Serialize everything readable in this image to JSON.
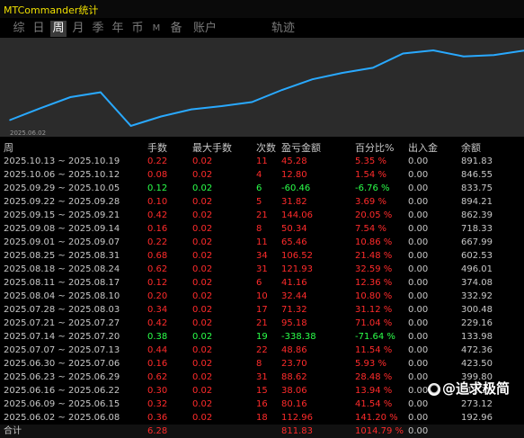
{
  "window": {
    "title": "MTCommander统计"
  },
  "tabs": [
    {
      "label": "综",
      "active": false
    },
    {
      "label": "日",
      "active": false
    },
    {
      "label": "周",
      "active": true
    },
    {
      "label": "月",
      "active": false
    },
    {
      "label": "季",
      "active": false
    },
    {
      "label": "年",
      "active": false
    },
    {
      "label": "币",
      "active": false
    },
    {
      "label": "M",
      "active": false
    },
    {
      "label": "备",
      "active": false
    },
    {
      "label": "账户",
      "active": false
    },
    {
      "label": "轨迹",
      "active": false
    }
  ],
  "chart_data": {
    "type": "line",
    "x_start_label": "2025.06.02",
    "series": [
      {
        "values": [
          192.96,
          311.18,
          423.5,
          472.36,
          133.98,
          229.16,
          300.48,
          332.92,
          374.08,
          496.01,
          602.53,
          667.99,
          718.33,
          862.39,
          894.21,
          833.75,
          846.55,
          891.83
        ]
      }
    ],
    "color": "#29a9ff",
    "background": "#2b2b2b"
  },
  "table": {
    "headers": {
      "date": "周",
      "lots": "手数",
      "max_lots": "最大手数",
      "count": "次数",
      "pnl": "盈亏金额",
      "pct": "百分比%",
      "inout": "出入金",
      "balance": "余额"
    },
    "rows": [
      {
        "date": "2025.10.13 ~ 2025.10.19",
        "lots": "0.22",
        "max": "0.02",
        "cnt": "11",
        "pnl": "45.28",
        "pct": "5.35 %",
        "io": "0.00",
        "bal": "891.83",
        "sign": "pos"
      },
      {
        "date": "2025.10.06 ~ 2025.10.12",
        "lots": "0.08",
        "max": "0.02",
        "cnt": "4",
        "pnl": "12.80",
        "pct": "1.54 %",
        "io": "0.00",
        "bal": "846.55",
        "sign": "pos"
      },
      {
        "date": "2025.09.29 ~ 2025.10.05",
        "lots": "0.12",
        "max": "0.02",
        "cnt": "6",
        "pnl": "-60.46",
        "pct": "-6.76 %",
        "io": "0.00",
        "bal": "833.75",
        "sign": "neg"
      },
      {
        "date": "2025.09.22 ~ 2025.09.28",
        "lots": "0.10",
        "max": "0.02",
        "cnt": "5",
        "pnl": "31.82",
        "pct": "3.69 %",
        "io": "0.00",
        "bal": "894.21",
        "sign": "pos"
      },
      {
        "date": "2025.09.15 ~ 2025.09.21",
        "lots": "0.42",
        "max": "0.02",
        "cnt": "21",
        "pnl": "144.06",
        "pct": "20.05 %",
        "io": "0.00",
        "bal": "862.39",
        "sign": "pos"
      },
      {
        "date": "2025.09.08 ~ 2025.09.14",
        "lots": "0.16",
        "max": "0.02",
        "cnt": "8",
        "pnl": "50.34",
        "pct": "7.54 %",
        "io": "0.00",
        "bal": "718.33",
        "sign": "pos"
      },
      {
        "date": "2025.09.01 ~ 2025.09.07",
        "lots": "0.22",
        "max": "0.02",
        "cnt": "11",
        "pnl": "65.46",
        "pct": "10.86 %",
        "io": "0.00",
        "bal": "667.99",
        "sign": "pos"
      },
      {
        "date": "2025.08.25 ~ 2025.08.31",
        "lots": "0.68",
        "max": "0.02",
        "cnt": "34",
        "pnl": "106.52",
        "pct": "21.48 %",
        "io": "0.00",
        "bal": "602.53",
        "sign": "pos"
      },
      {
        "date": "2025.08.18 ~ 2025.08.24",
        "lots": "0.62",
        "max": "0.02",
        "cnt": "31",
        "pnl": "121.93",
        "pct": "32.59 %",
        "io": "0.00",
        "bal": "496.01",
        "sign": "pos"
      },
      {
        "date": "2025.08.11 ~ 2025.08.17",
        "lots": "0.12",
        "max": "0.02",
        "cnt": "6",
        "pnl": "41.16",
        "pct": "12.36 %",
        "io": "0.00",
        "bal": "374.08",
        "sign": "pos"
      },
      {
        "date": "2025.08.04 ~ 2025.08.10",
        "lots": "0.20",
        "max": "0.02",
        "cnt": "10",
        "pnl": "32.44",
        "pct": "10.80 %",
        "io": "0.00",
        "bal": "332.92",
        "sign": "pos"
      },
      {
        "date": "2025.07.28 ~ 2025.08.03",
        "lots": "0.34",
        "max": "0.02",
        "cnt": "17",
        "pnl": "71.32",
        "pct": "31.12 %",
        "io": "0.00",
        "bal": "300.48",
        "sign": "pos"
      },
      {
        "date": "2025.07.21 ~ 2025.07.27",
        "lots": "0.42",
        "max": "0.02",
        "cnt": "21",
        "pnl": "95.18",
        "pct": "71.04 %",
        "io": "0.00",
        "bal": "229.16",
        "sign": "pos"
      },
      {
        "date": "2025.07.14 ~ 2025.07.20",
        "lots": "0.38",
        "max": "0.02",
        "cnt": "19",
        "pnl": "-338.38",
        "pct": "-71.64 %",
        "io": "0.00",
        "bal": "133.98",
        "sign": "neg"
      },
      {
        "date": "2025.07.07 ~ 2025.07.13",
        "lots": "0.44",
        "max": "0.02",
        "cnt": "22",
        "pnl": "48.86",
        "pct": "11.54 %",
        "io": "0.00",
        "bal": "472.36",
        "sign": "pos"
      },
      {
        "date": "2025.06.30 ~ 2025.07.06",
        "lots": "0.16",
        "max": "0.02",
        "cnt": "8",
        "pnl": "23.70",
        "pct": "5.93 %",
        "io": "0.00",
        "bal": "423.50",
        "sign": "pos"
      },
      {
        "date": "2025.06.23 ~ 2025.06.29",
        "lots": "0.62",
        "max": "0.02",
        "cnt": "31",
        "pnl": "88.62",
        "pct": "28.48 %",
        "io": "0.00",
        "bal": "399.80",
        "sign": "pos"
      },
      {
        "date": "2025.06.16 ~ 2025.06.22",
        "lots": "0.30",
        "max": "0.02",
        "cnt": "15",
        "pnl": "38.06",
        "pct": "13.94 %",
        "io": "0.00",
        "bal": "311.18",
        "sign": "pos"
      },
      {
        "date": "2025.06.09 ~ 2025.06.15",
        "lots": "0.32",
        "max": "0.02",
        "cnt": "16",
        "pnl": "80.16",
        "pct": "41.54 %",
        "io": "0.00",
        "bal": "273.12",
        "sign": "pos"
      },
      {
        "date": "2025.06.02 ~ 2025.06.08",
        "lots": "0.36",
        "max": "0.02",
        "cnt": "18",
        "pnl": "112.96",
        "pct": "141.20 %",
        "io": "0.00",
        "bal": "192.96",
        "sign": "pos"
      }
    ],
    "total": {
      "date": "合计",
      "lots": "6.28",
      "max": "",
      "cnt": "",
      "pnl": "811.83",
      "pct": "1014.79 %",
      "io": "0.00",
      "bal": ""
    }
  },
  "watermark": {
    "text": "@追求极简"
  }
}
